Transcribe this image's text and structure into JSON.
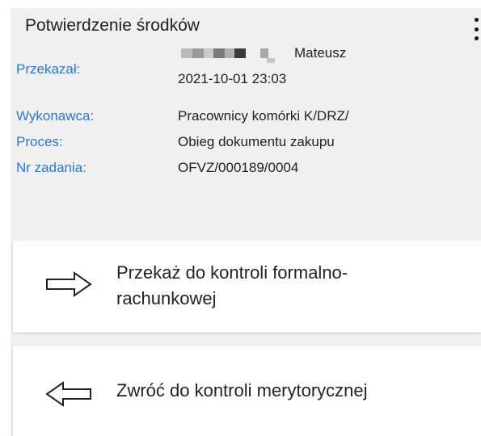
{
  "panel": {
    "title": "Potwierdzenie środków"
  },
  "fields": {
    "przekazal": {
      "label": "Przekazał:",
      "name": "Mateusz",
      "datetime": "2021-10-01 23:03"
    },
    "wykonawca": {
      "label": "Wykonawca:",
      "value": "Pracownicy komórki K/DRZ/"
    },
    "proces": {
      "label": "Proces:",
      "value": "Obieg dokumentu zakupu"
    },
    "nr_zadania": {
      "label": "Nr zadania:",
      "value": "OFVZ/000189/0004"
    }
  },
  "actions": {
    "forward": {
      "label": "Przekaż do kontroli formalno-rachunkowej",
      "icon": "arrow-right-icon"
    },
    "return": {
      "label": "Zwróć do kontroli merytorycznej",
      "icon": "arrow-left-icon"
    }
  },
  "colors": {
    "label": "#2b79c2",
    "panel_background": "#f0f0f0",
    "button_background": "#ffffff"
  }
}
